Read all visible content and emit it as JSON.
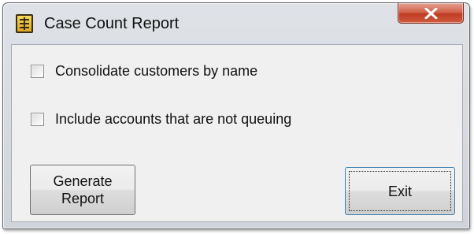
{
  "window": {
    "title": "Case Count Report",
    "app_icon": "calculator-icon",
    "close_icon": "close-x-icon",
    "close_color": "#c8472c"
  },
  "options": [
    {
      "label": "Consolidate customers by name",
      "checked": false
    },
    {
      "label": "Include accounts that are not queuing",
      "checked": false
    }
  ],
  "buttons": {
    "generate_label": "Generate Report",
    "exit_label": "Exit"
  }
}
